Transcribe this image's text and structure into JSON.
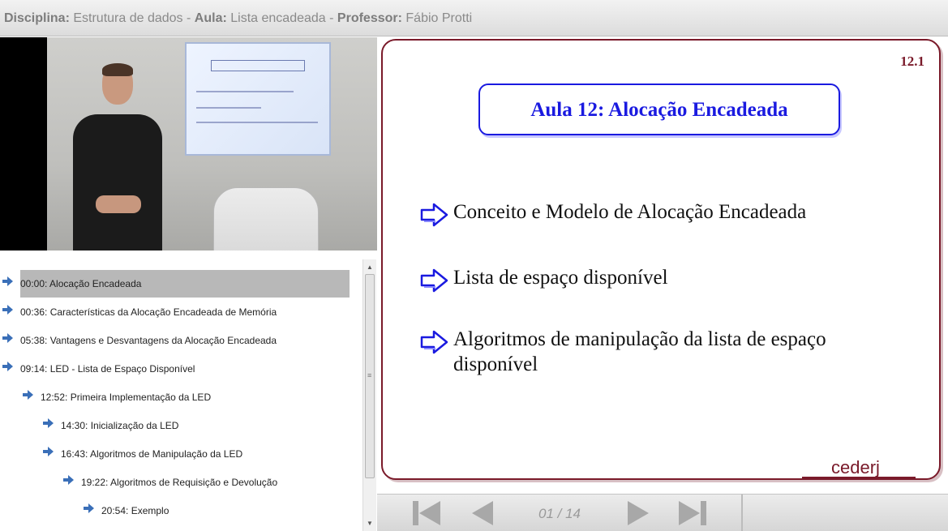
{
  "header": {
    "disciplina_label": "Disciplina:",
    "disciplina_value": "Estrutura de dados",
    "sep1": "-",
    "aula_label": "Aula:",
    "aula_value": "Lista encadeada",
    "sep2": "-",
    "professor_label": "Professor:",
    "professor_value": "Fábio Protti"
  },
  "index": {
    "items": [
      {
        "label": "00:00: Alocação Encadeada",
        "level": 0,
        "selected": true
      },
      {
        "label": "00:36: Características da Alocação Encadeada de Memória",
        "level": 0,
        "selected": false
      },
      {
        "label": "05:38: Vantagens e Desvantagens da Alocação Encadeada",
        "level": 0,
        "selected": false
      },
      {
        "label": "09:14: LED - Lista de Espaço Disponível",
        "level": 0,
        "selected": false
      },
      {
        "label": "12:52: Primeira Implementação da LED",
        "level": 1,
        "selected": false
      },
      {
        "label": "14:30: Inicialização da LED",
        "level": 2,
        "selected": false
      },
      {
        "label": "16:43: Algoritmos de Manipulação da LED",
        "level": 2,
        "selected": false
      },
      {
        "label": "19:22: Algoritmos de Requisição e Devolução",
        "level": 3,
        "selected": false
      },
      {
        "label": "20:54: Exemplo",
        "level": 4,
        "selected": false
      }
    ]
  },
  "slide": {
    "number": "12.1",
    "title": "Aula 12: Alocação Encadeada",
    "bullets": [
      "Conceito e Modelo de Alocação Encadeada",
      "Lista de espaço disponível",
      "Algoritmos de manipulação da lista de espaço disponível"
    ],
    "logo": "cederj"
  },
  "controls": {
    "page": "01 / 14",
    "icons": [
      "first-icon",
      "previous-icon",
      "next-icon",
      "last-icon"
    ]
  },
  "colors": {
    "accent_blue": "#1a1ae0",
    "slide_border": "#7a1a2a",
    "arrow_blue": "#3a6fb8",
    "control_gray": "#a9a9a9"
  }
}
